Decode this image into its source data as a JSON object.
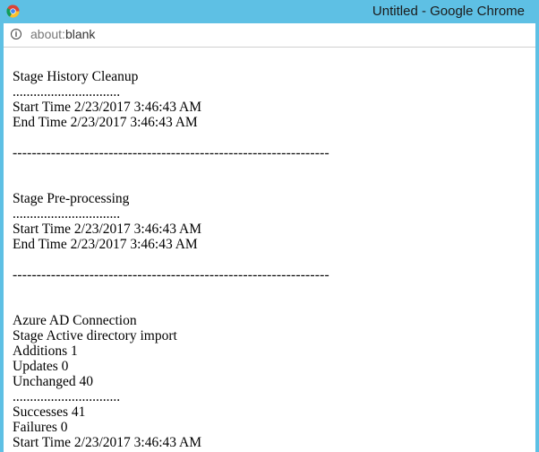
{
  "window": {
    "title": "Untitled - Google Chrome"
  },
  "addressbar": {
    "scheme": "about:",
    "path": "blank",
    "info_icon": "info-icon"
  },
  "page": {
    "lines": [
      "Stage History Cleanup",
      "...............................",
      "Start Time 2/23/2017 3:46:43 AM",
      "End Time 2/23/2017 3:46:43 AM",
      "",
      "------------------------------------------------------------------",
      "",
      "",
      "Stage Pre-processing",
      "...............................",
      "Start Time 2/23/2017 3:46:43 AM",
      "End Time 2/23/2017 3:46:43 AM",
      "",
      "------------------------------------------------------------------",
      "",
      "",
      "Azure AD Connection",
      "Stage Active directory import",
      "Additions 1",
      "Updates 0",
      "Unchanged 40",
      "...............................",
      "Successes 41",
      "Failures 0",
      "Start Time 2/23/2017 3:46:43 AM"
    ]
  }
}
